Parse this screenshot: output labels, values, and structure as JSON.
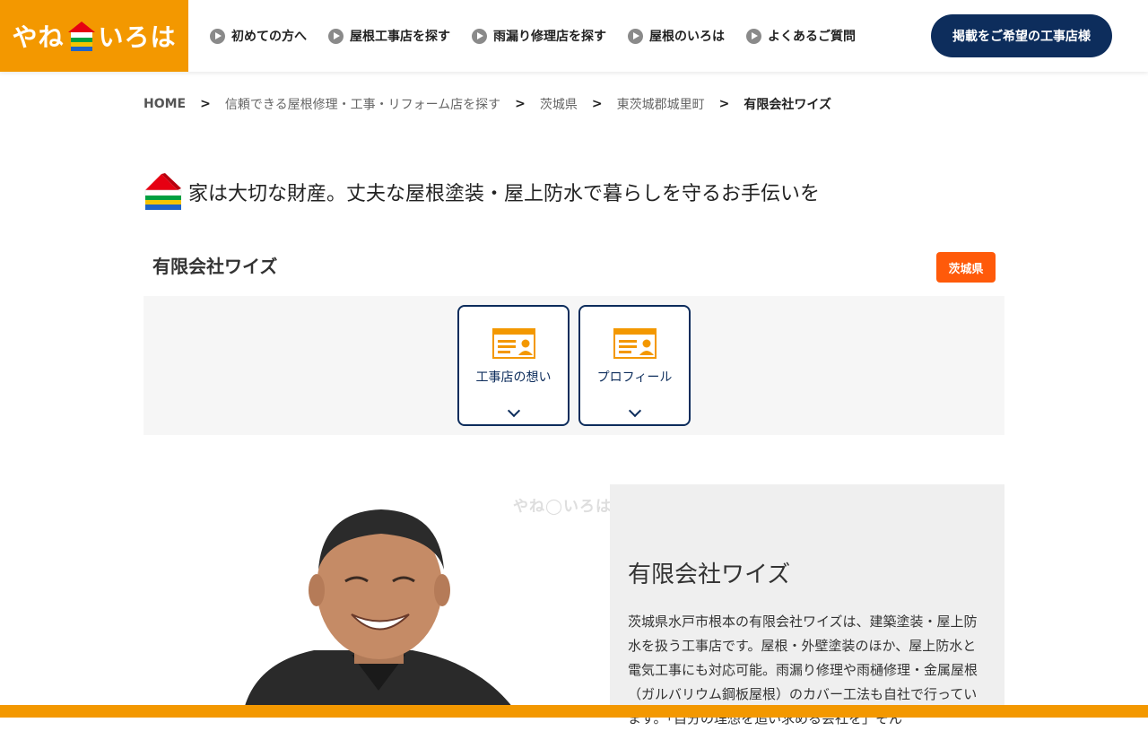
{
  "header": {
    "logo_left": "やね",
    "logo_right": "いろは",
    "nav": [
      {
        "label": "初めての方へ"
      },
      {
        "label": "屋根工事店を探す"
      },
      {
        "label": "雨漏り修理店を探す"
      },
      {
        "label": "屋根のいろは"
      },
      {
        "label": "よくあるご質問"
      }
    ],
    "cta_label": "掲載をご希望の工事店様"
  },
  "breadcrumb": {
    "home": "HOME",
    "items": [
      "信頼できる屋根修理・工事・リフォーム店を探す",
      "茨城県",
      "東茨城郡城里町"
    ],
    "current": "有限会社ワイズ",
    "separator": ">"
  },
  "headline": "家は大切な財産。丈夫な屋根塗装・屋上防水で暮らしを守るお手伝いを",
  "company": {
    "name": "有限会社ワイズ",
    "prefecture": "茨城県"
  },
  "tabs": [
    {
      "label": "工事店の想い"
    },
    {
      "label": "プロフィール"
    }
  ],
  "profile": {
    "watermark": "やね◯いろは",
    "title": "有限会社ワイズ",
    "description": "茨城県水戸市根本の有限会社ワイズは、建築塗装・屋上防水を扱う工事店です。屋根・外壁塗装のほか、屋上防水と電気工事にも対応可能。雨漏り修理や雨樋修理・金属屋根（ガルバリウム鋼板屋根）のカバー工法も自社で行っています。「自分の理想を追い求める会社を」そん"
  },
  "colors": {
    "brand_orange": "#f39800",
    "navy": "#0d2d5c",
    "badge_orange": "#ff5a0a"
  }
}
